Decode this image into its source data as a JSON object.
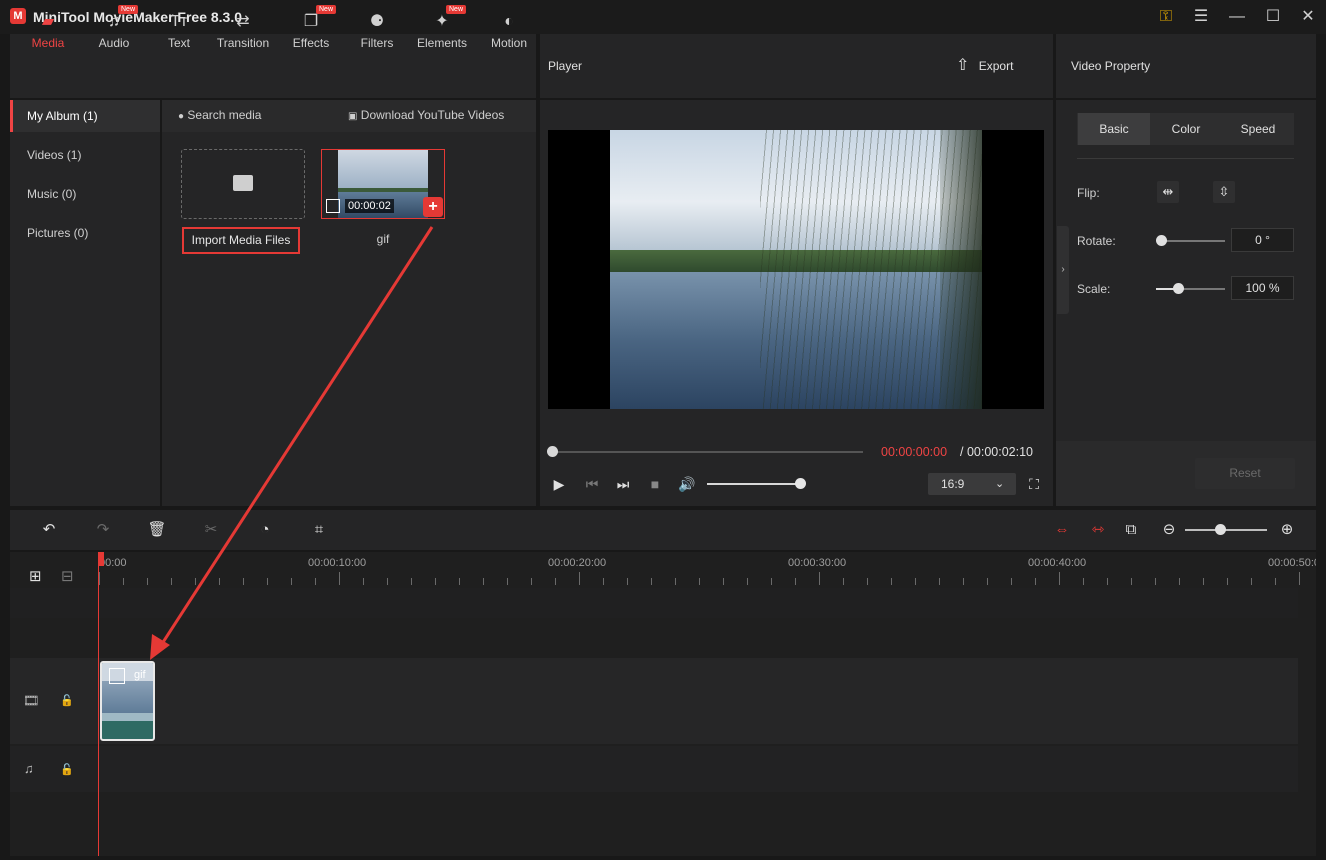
{
  "app": {
    "title": "MiniTool MovieMaker Free 8.3.0",
    "logo": "M"
  },
  "window_controls": {
    "key_icon": "⚿",
    "menu_icon": "☰",
    "minimize_icon": "—",
    "maximize_icon": "☐",
    "close_icon": "✕"
  },
  "toolbar": {
    "items": [
      {
        "label": "Media",
        "icon": "folder-icon",
        "badge": ""
      },
      {
        "label": "Audio",
        "icon": "music-note-icon",
        "badge": "New"
      },
      {
        "label": "Text",
        "icon": "text-icon",
        "badge": ""
      },
      {
        "label": "Transition",
        "icon": "transition-icon",
        "badge": ""
      },
      {
        "label": "Effects",
        "icon": "effects-icon",
        "badge": "New"
      },
      {
        "label": "Filters",
        "icon": "filters-icon",
        "badge": ""
      },
      {
        "label": "Elements",
        "icon": "elements-icon",
        "badge": "New"
      },
      {
        "label": "Motion",
        "icon": "motion-icon",
        "badge": ""
      }
    ],
    "glyphs": [
      "▰",
      "♫",
      "Tт",
      "⇄",
      "❐",
      "⚈",
      "✦",
      "◐"
    ]
  },
  "album": {
    "items": [
      {
        "label": "My Album (1)",
        "active": true
      },
      {
        "label": "Videos (1)",
        "active": false
      },
      {
        "label": "Music (0)",
        "active": false
      },
      {
        "label": "Pictures (0)",
        "active": false
      }
    ]
  },
  "media": {
    "search_label": "Search media",
    "download_label": "Download YouTube Videos",
    "import_label": "Import Media Files",
    "clip_name": "gif",
    "clip_duration": "00:00:02",
    "add_glyph": "+"
  },
  "player": {
    "title": "Player",
    "export_label": "Export",
    "export_glyph": "⇧",
    "time_current": "00:00:00:00",
    "time_total": "/ 00:00:02:10",
    "aspect_ratio": "16:9",
    "chevron": "⌄",
    "progress": 0.0,
    "volume": 0.98,
    "glyphs": {
      "play": "▶",
      "prev": "⏮",
      "next": "⏭",
      "stop": "■",
      "volume": "🔊",
      "fullscreen": "⛶"
    }
  },
  "property": {
    "title": "Video Property",
    "tabs": [
      "Basic",
      "Color",
      "Speed"
    ],
    "flip_label": "Flip:",
    "rotate_label": "Rotate:",
    "rotate_value": "0 °",
    "scale_label": "Scale:",
    "scale_value": "100 %",
    "reset_label": "Reset",
    "collapse_glyph": "›",
    "flip_h_glyph": "⇹",
    "flip_v_glyph": "⇳"
  },
  "timeline": {
    "ticks": [
      "00:00",
      "00:00:10:00",
      "00:00:20:00",
      "00:00:30:00",
      "00:00:40:00",
      "00:00:50:0"
    ],
    "clip_name": "gif",
    "glyphs": {
      "undo": "↶",
      "redo": "↷",
      "delete": "🗑",
      "cut": "✂",
      "speed": "◔",
      "crop": "⌗",
      "zoom_out": "⊖",
      "zoom_in": "⊕",
      "video_track": "🎞",
      "audio_track": "♫",
      "lock": "🔓",
      "add_track": "⊞",
      "remove_track": "⊟",
      "fit": "⇔",
      "split": "⇿",
      "snap": "⧉"
    },
    "zoom_level": 0.45
  },
  "colors": {
    "accent": "#e53935",
    "panel": "#252526",
    "background": "#181818"
  }
}
